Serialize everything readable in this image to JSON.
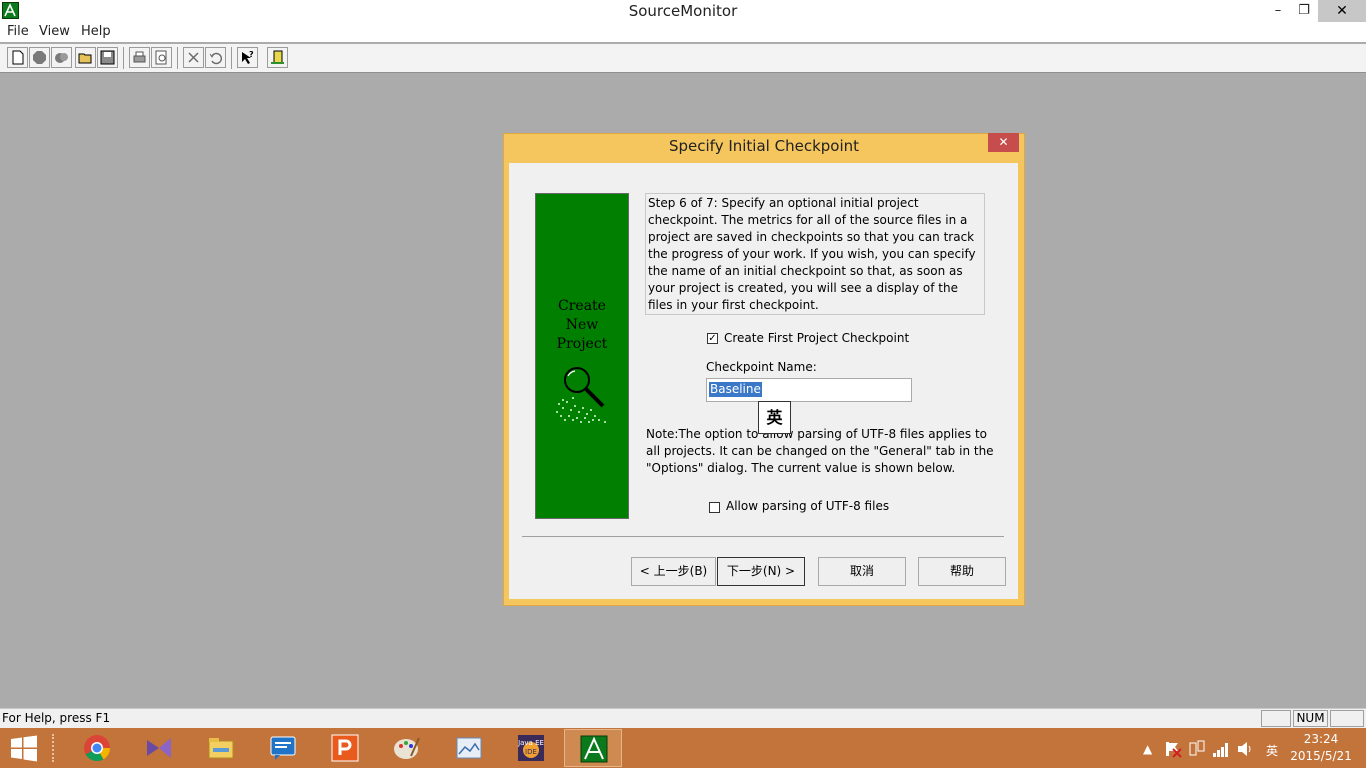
{
  "window": {
    "title": "SourceMonitor",
    "controls": {
      "minimize": "–",
      "restore": "❐",
      "close": "✕"
    }
  },
  "menu": [
    "File",
    "View",
    "Help"
  ],
  "toolbar": {
    "buttons": [
      "new-icon",
      "stop-icon",
      "copy-icon",
      "open-icon",
      "save-icon",
      "print-icon",
      "print-preview-icon",
      "delete-icon",
      "undo-icon",
      "context-help-icon",
      "exit-icon"
    ]
  },
  "dialog": {
    "title": "Specify Initial Checkpoint",
    "close": "✕",
    "panel_text": [
      "Create",
      "New",
      "Project"
    ],
    "step_text": "Step 6 of 7: Specify an optional initial project checkpoint. The metrics for all of the source files in a project are saved in checkpoints so that you can track the progress of your work. If you wish, you can specify the name of an initial checkpoint so that, as soon as your project is created, you will see a display of the files in your first checkpoint.",
    "create_checkpoint": {
      "label": "Create First Project Checkpoint",
      "checked": true,
      "mark": "✓"
    },
    "checkpoint_name_label": "Checkpoint Name:",
    "checkpoint_name_value": "Baseline",
    "ime_indicator": "英",
    "note_text": "Note:The option to allow parsing of UTF-8 files applies to all projects. It can be changed on the \"General\" tab in the \"Options\" dialog. The current value is shown below.",
    "utf8": {
      "label": "Allow parsing of UTF-8 files",
      "checked": false
    },
    "buttons": {
      "back": "< 上一步(B)",
      "next": "下一步(N) >",
      "cancel": "取消",
      "help": "帮助"
    }
  },
  "statusbar": {
    "text": "For Help, press F1",
    "num": "NUM"
  },
  "taskbar": {
    "apps": [
      "chrome-icon",
      "visual-studio-icon",
      "file-explorer-icon",
      "messenger-icon",
      "powerpoint-icon",
      "paint-icon",
      "photo-viewer-icon",
      "javaee-ide-icon",
      "sourcemonitor-icon"
    ],
    "tray": {
      "ime": "英",
      "time": "23:24",
      "date": "2015/5/21"
    }
  },
  "colors": {
    "dialog_frame": "#f5c55e",
    "panel_green": "#007f00",
    "selection": "#3b78c7",
    "taskbar": "#c3743b"
  }
}
